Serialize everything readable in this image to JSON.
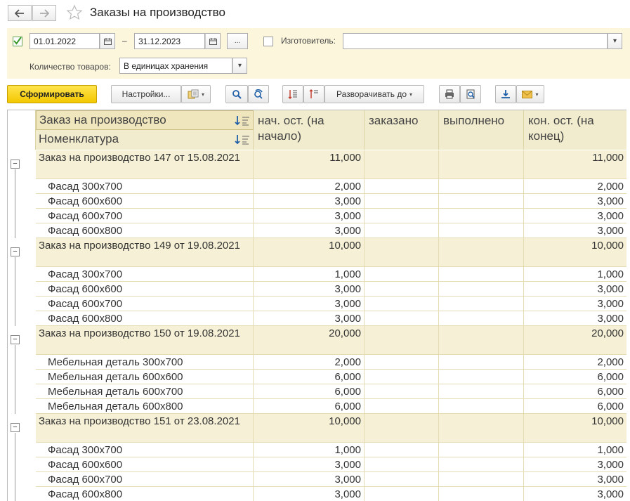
{
  "window": {
    "title": "Заказы на производство"
  },
  "filters": {
    "period_start": "01.01.2022",
    "period_dash": "–",
    "period_end": "31.12.2023",
    "more_label": "...",
    "manufacturer_label": "Изготовитель:",
    "manufacturer_value": "",
    "quantity_label": "Количество товаров:",
    "quantity_value": "В единицах хранения"
  },
  "toolbar": {
    "generate": "Сформировать",
    "settings": "Настройки...",
    "expand_to": "Разворачивать до"
  },
  "table": {
    "headers": {
      "order": "Заказ на производство",
      "nomenclature": "Номенклатура",
      "start": "нач. ост. (на начало)",
      "ordered": "заказано",
      "done": "выполнено",
      "end": "кон. ост. (на конец)"
    },
    "groups": [
      {
        "order": "Заказ на производство 147 от 15.08.2021",
        "start": "11,000",
        "ordered": "",
        "done": "",
        "end": "11,000",
        "items": [
          {
            "name": "Фасад 300х700",
            "start": "2,000",
            "ordered": "",
            "done": "",
            "end": "2,000"
          },
          {
            "name": "Фасад 600х600",
            "start": "3,000",
            "ordered": "",
            "done": "",
            "end": "3,000"
          },
          {
            "name": "Фасад 600х700",
            "start": "3,000",
            "ordered": "",
            "done": "",
            "end": "3,000"
          },
          {
            "name": "Фасад 600х800",
            "start": "3,000",
            "ordered": "",
            "done": "",
            "end": "3,000"
          }
        ]
      },
      {
        "order": "Заказ на производство 149 от 19.08.2021",
        "start": "10,000",
        "ordered": "",
        "done": "",
        "end": "10,000",
        "items": [
          {
            "name": "Фасад 300х700",
            "start": "1,000",
            "ordered": "",
            "done": "",
            "end": "1,000"
          },
          {
            "name": "Фасад 600х600",
            "start": "3,000",
            "ordered": "",
            "done": "",
            "end": "3,000"
          },
          {
            "name": "Фасад 600х700",
            "start": "3,000",
            "ordered": "",
            "done": "",
            "end": "3,000"
          },
          {
            "name": "Фасад 600х800",
            "start": "3,000",
            "ordered": "",
            "done": "",
            "end": "3,000"
          }
        ]
      },
      {
        "order": "Заказ на производство 150 от 19.08.2021",
        "start": "20,000",
        "ordered": "",
        "done": "",
        "end": "20,000",
        "items": [
          {
            "name": "Мебельная деталь 300х700",
            "start": "2,000",
            "ordered": "",
            "done": "",
            "end": "2,000"
          },
          {
            "name": "Мебельная деталь 600х600",
            "start": "6,000",
            "ordered": "",
            "done": "",
            "end": "6,000"
          },
          {
            "name": "Мебельная деталь 600х700",
            "start": "6,000",
            "ordered": "",
            "done": "",
            "end": "6,000"
          },
          {
            "name": "Мебельная деталь 600х800",
            "start": "6,000",
            "ordered": "",
            "done": "",
            "end": "6,000"
          }
        ]
      },
      {
        "order": "Заказ на производство 151 от 23.08.2021",
        "start": "10,000",
        "ordered": "",
        "done": "",
        "end": "10,000",
        "items": [
          {
            "name": "Фасад 300х700",
            "start": "1,000",
            "ordered": "",
            "done": "",
            "end": "1,000"
          },
          {
            "name": "Фасад 600х600",
            "start": "3,000",
            "ordered": "",
            "done": "",
            "end": "3,000"
          },
          {
            "name": "Фасад 600х700",
            "start": "3,000",
            "ordered": "",
            "done": "",
            "end": "3,000"
          },
          {
            "name": "Фасад 600х800",
            "start": "3,000",
            "ordered": "",
            "done": "",
            "end": "3,000"
          }
        ]
      }
    ]
  },
  "colors": {
    "accent": "#f3c700",
    "panel": "#fbf6dc",
    "group_row": "#f6f1d6",
    "check": "#3a9a2a"
  }
}
